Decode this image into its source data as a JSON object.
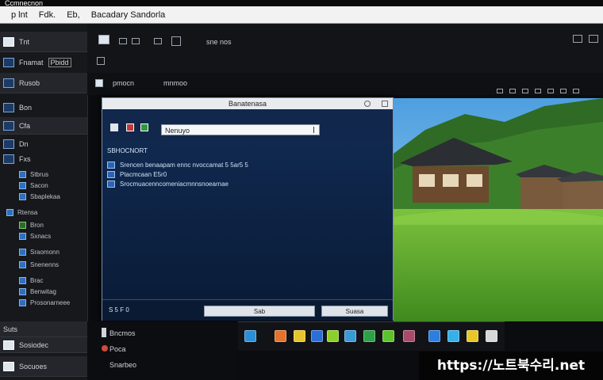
{
  "window": {
    "title": "Ccmnecnon"
  },
  "menu": {
    "items": [
      "p lnt",
      "Fdk.",
      "Eb,",
      "Bacadary Sandorla"
    ]
  },
  "sidebar": {
    "rows": [
      {
        "label": "Tnt",
        "icon": "folder-icon"
      },
      {
        "label": "Fnamat",
        "badge": "Pbidd",
        "icon": "folder-icon"
      },
      {
        "label": "Rusob",
        "icon": "drive-icon"
      },
      {
        "label": "Bon",
        "icon": "document-icon"
      },
      {
        "label": "Cfa",
        "icon": "folder-icon"
      },
      {
        "label": "Dn",
        "icon": "folder-icon"
      },
      {
        "label": "Fxs",
        "icon": "folder-icon"
      }
    ],
    "sub_items": [
      "Stbrus",
      "Sacon",
      "Sbaplekaa",
      "Rtensa",
      "Bron",
      "Sxnacs",
      "Sraomonn",
      "Snenenns",
      "Brac",
      "Benwitag",
      "Prosonarneee"
    ],
    "bottom_rows": [
      {
        "label": "Suts",
        "icon": "folder-icon"
      },
      {
        "label": "Sosiodec",
        "icon": "folder-icon"
      },
      {
        "label": "Socuoes",
        "icon": "monitor-icon"
      }
    ]
  },
  "toolbar": {
    "path_label": "sne nos",
    "crumb_left": "pmocn",
    "crumb_right": "mnmoo"
  },
  "dialog": {
    "title": "Banatenasa",
    "search_value": "Nenuyo",
    "section_label": "SBHOCNORT",
    "rows": [
      "Srencen  benaapam  ennc  nvoccamat  5 5ar5 5",
      "Ptacmcaan  E5r0",
      "Srocmuacenncomeniacmnnsnoearnae"
    ],
    "footer_left": "S 5 F 0",
    "ok_label": "Sab",
    "cancel_label": "Suasa"
  },
  "bottom_panel": {
    "line1": "Bncmos",
    "line2": "Poca",
    "line3": "Snarbeo"
  },
  "watermark": "https://노트북수리.net",
  "colors": {
    "dialog_bg": "#0c1f3d",
    "accent": "#2c64b5",
    "grass": "#5ea630",
    "sky": "#6ab3ea"
  }
}
